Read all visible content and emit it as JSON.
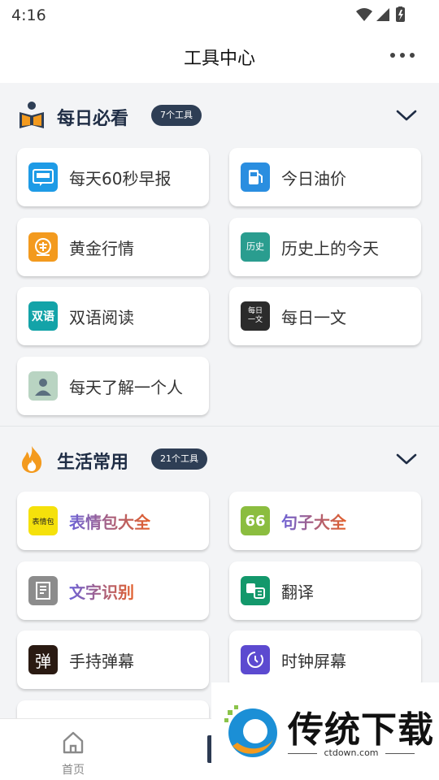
{
  "status": {
    "time": "4:16"
  },
  "header": {
    "title": "工具中心"
  },
  "sections": [
    {
      "title": "每日必看",
      "badge": "7个工具",
      "items": [
        {
          "label": "每天60秒早报",
          "icon": "newspaper-icon"
        },
        {
          "label": "今日油价",
          "icon": "fuel-pump-icon"
        },
        {
          "label": "黄金行情",
          "icon": "gold-coin-icon"
        },
        {
          "label": "历史上的今天",
          "icon": "history-icon",
          "icon_text": "历史"
        },
        {
          "label": "双语阅读",
          "icon": "bilingual-icon",
          "icon_text": "双语"
        },
        {
          "label": "每日一文",
          "icon": "daily-article-icon",
          "icon_text": "每日一文"
        },
        {
          "label": "每天了解一个人",
          "icon": "person-icon"
        }
      ]
    },
    {
      "title": "生活常用",
      "badge": "21个工具",
      "items": [
        {
          "label": "表情包大全",
          "icon": "emoji-pack-icon",
          "icon_text": "表情包"
        },
        {
          "label": "句子大全",
          "icon": "quote-icon",
          "icon_text": "66"
        },
        {
          "label": "文字识别",
          "icon": "ocr-icon"
        },
        {
          "label": "翻译",
          "icon": "translate-icon"
        },
        {
          "label": "手持弹幕",
          "icon": "danmaku-icon",
          "icon_text": "弹"
        },
        {
          "label": "时钟屏幕",
          "icon": "clock-icon"
        }
      ]
    }
  ],
  "tabbar": {
    "home_label": "首页"
  },
  "watermark": {
    "title": "传统下载",
    "url": "ctdown.com"
  },
  "colors": {
    "accent": "#2e3e55",
    "orange": "#f39a1e",
    "page_bg": "#f3f4f6"
  }
}
